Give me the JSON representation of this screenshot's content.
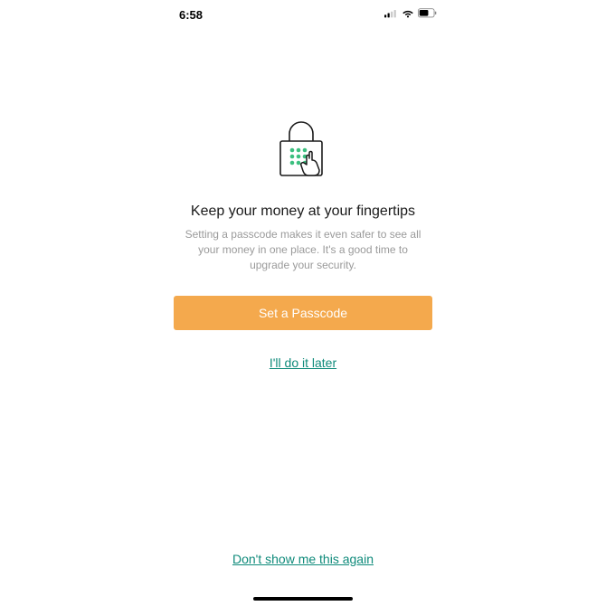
{
  "status": {
    "time": "6:58"
  },
  "screen": {
    "headline": "Keep your money at your fingertips",
    "subtext": "Setting a passcode makes it even safer to see all your money in one place. It's a good time to upgrade your security.",
    "primary_button_label": "Set a Passcode",
    "secondary_link_label": "I'll do it later",
    "footer_link_label": "Don't show me this again"
  },
  "colors": {
    "accent_orange": "#f4a94d",
    "accent_teal": "#0e8a7a",
    "dot_green": "#3cbf7f"
  }
}
